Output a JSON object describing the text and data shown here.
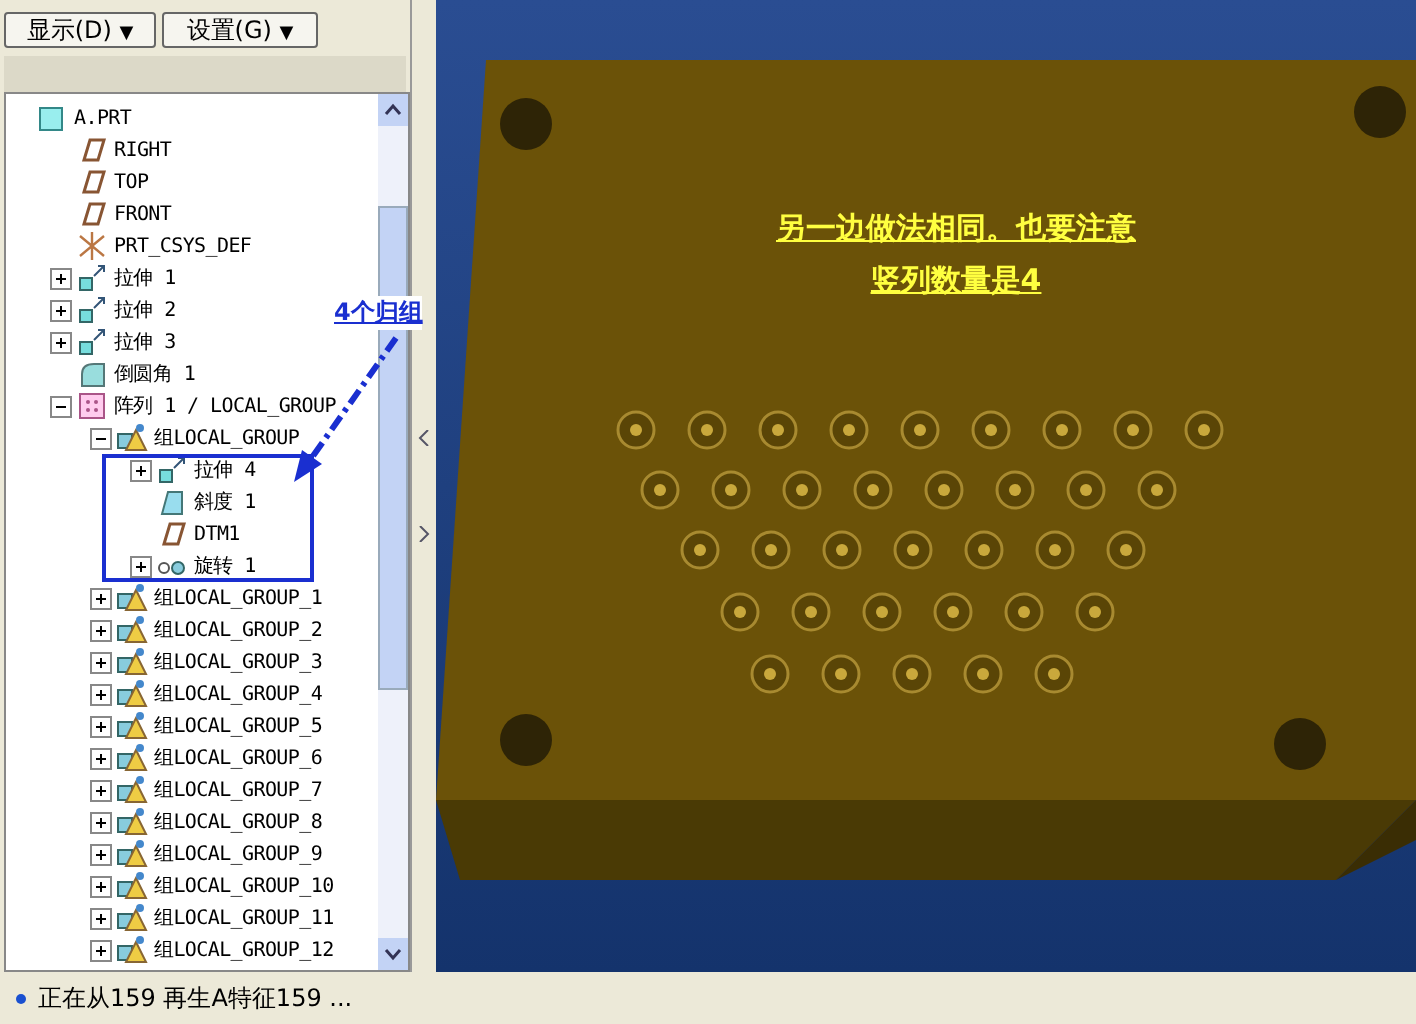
{
  "toolbar": {
    "buttons": [
      {
        "label": "显示(D)",
        "caret": "▼"
      },
      {
        "label": "设置(G)",
        "caret": "▼"
      }
    ]
  },
  "tree": {
    "label": "A.PRT",
    "kind": "part",
    "children": [
      {
        "label": "RIGHT",
        "kind": "plane"
      },
      {
        "label": "TOP",
        "kind": "plane"
      },
      {
        "label": "FRONT",
        "kind": "plane"
      },
      {
        "label": "PRT_CSYS_DEF",
        "kind": "csys"
      },
      {
        "label": "拉伸 1",
        "kind": "extrude",
        "expanded": false
      },
      {
        "label": "拉伸 2",
        "kind": "extrude",
        "expanded": false
      },
      {
        "label": "拉伸 3",
        "kind": "extrude",
        "expanded": false
      },
      {
        "label": "倒圆角 1",
        "kind": "round"
      },
      {
        "label": "阵列 1 / LOCAL_GROUP",
        "kind": "pattern",
        "expanded": true,
        "children": [
          {
            "label": "组LOCAL_GROUP",
            "kind": "group",
            "expanded": true,
            "highlighted": true,
            "children": [
              {
                "label": "拉伸 4",
                "kind": "extrude",
                "expanded": false
              },
              {
                "label": "斜度 1",
                "kind": "draft"
              },
              {
                "label": "DTM1",
                "kind": "plane"
              },
              {
                "label": "旋转 1",
                "kind": "revolve",
                "expanded": false
              }
            ]
          },
          {
            "label": "组LOCAL_GROUP_1",
            "kind": "group",
            "expanded": false
          },
          {
            "label": "组LOCAL_GROUP_2",
            "kind": "group",
            "expanded": false
          },
          {
            "label": "组LOCAL_GROUP_3",
            "kind": "group",
            "expanded": false
          },
          {
            "label": "组LOCAL_GROUP_4",
            "kind": "group",
            "expanded": false
          },
          {
            "label": "组LOCAL_GROUP_5",
            "kind": "group",
            "expanded": false
          },
          {
            "label": "组LOCAL_GROUP_6",
            "kind": "group",
            "expanded": false
          },
          {
            "label": "组LOCAL_GROUP_7",
            "kind": "group",
            "expanded": false
          },
          {
            "label": "组LOCAL_GROUP_8",
            "kind": "group",
            "expanded": false
          },
          {
            "label": "组LOCAL_GROUP_9",
            "kind": "group",
            "expanded": false
          },
          {
            "label": "组LOCAL_GROUP_10",
            "kind": "group",
            "expanded": false
          },
          {
            "label": "组LOCAL_GROUP_11",
            "kind": "group",
            "expanded": false
          },
          {
            "label": "组LOCAL_GROUP_12",
            "kind": "group",
            "expanded": false
          }
        ]
      }
    ]
  },
  "callout": "4个归组",
  "viewport": {
    "note": [
      "另一边做法相同。也要注意",
      "竖列数量是4"
    ]
  },
  "status_bar": "正在从159 再生A特征159 ..."
}
